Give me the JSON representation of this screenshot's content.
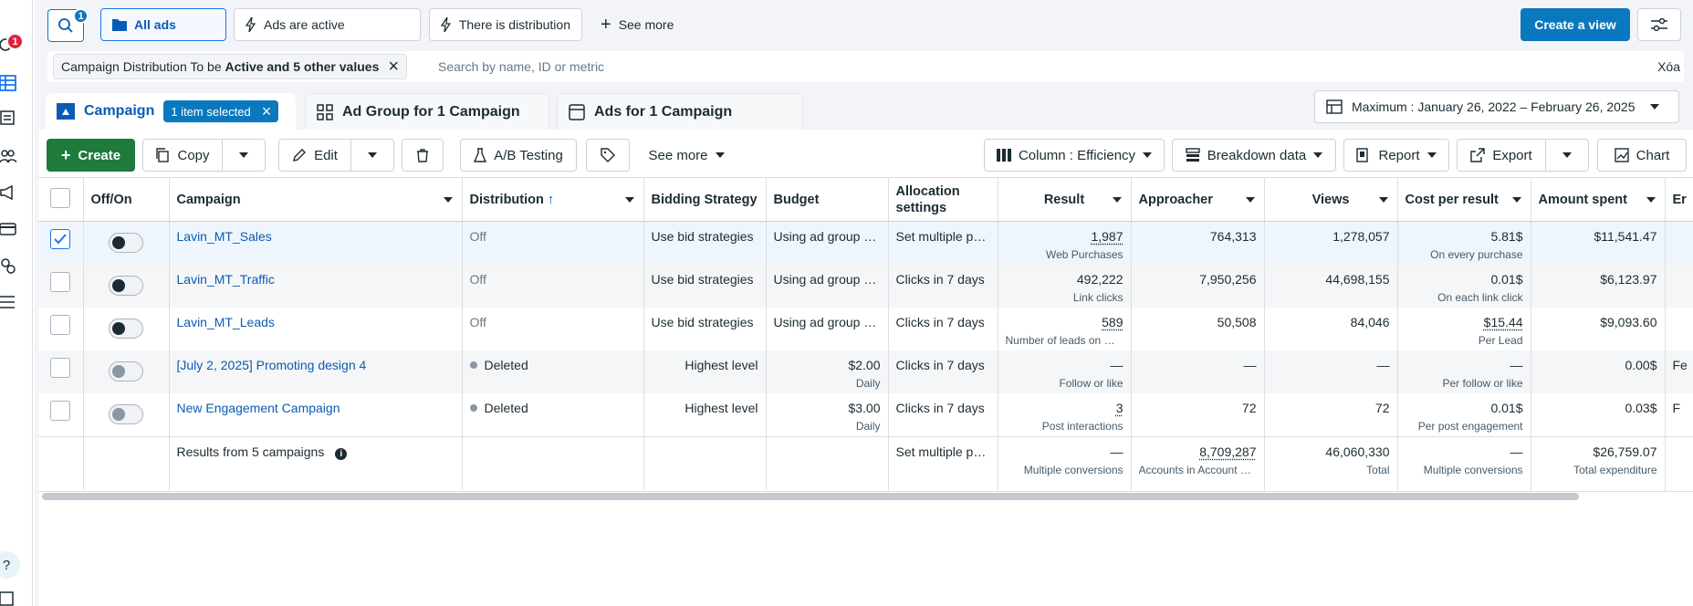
{
  "rail": {
    "badge": "1",
    "help": "?"
  },
  "topbar": {
    "search_badge": "1",
    "tabs": [
      "All ads",
      "Ads are active",
      "There is distribution"
    ],
    "see_more": "See more",
    "create_view": "Create a view"
  },
  "filter": {
    "chip_prefix": "Campaign Distribution To be",
    "chip_value": "Active and 5 other values",
    "search_placeholder": "Search by name, ID or metric",
    "clear": "Xóa"
  },
  "level_tabs": {
    "campaign": "Campaign",
    "selected_pill": "1 item selected",
    "ad_group": "Ad Group for 1 Campaign",
    "ads": "Ads for 1 Campaign"
  },
  "date_range": "Maximum : January 26, 2022 – February 26, 2025",
  "toolbar": {
    "create": "Create",
    "copy": "Copy",
    "edit": "Edit",
    "ab_testing": "A/B Testing",
    "see_more": "See more",
    "column": "Column : Efficiency",
    "breakdown": "Breakdown data",
    "report": "Report",
    "export": "Export",
    "chart": "Chart"
  },
  "table": {
    "headers": {
      "offon": "Off/On",
      "campaign": "Campaign",
      "distribution": "Distribution",
      "bidding": "Bidding Strategy",
      "budget": "Budget",
      "allocation": "Allocation settings",
      "result": "Result",
      "approacher": "Approacher",
      "views": "Views",
      "cpr": "Cost per result",
      "spent": "Amount spent",
      "extra": "Er"
    },
    "rows": [
      {
        "name": "Lavin_MT_Sales",
        "distribution": "Off",
        "bidding": "Use bid strategies",
        "budget": "Using ad group budget",
        "budget_sub": "",
        "allocation": "Set multiple presets",
        "result": "1,987",
        "result_sub": "Web Purchases",
        "approacher": "764,313",
        "views": "1,278,057",
        "cpr": "5.81$",
        "cpr_sub": "On every purchase",
        "spent": "$11,541.47",
        "extra": ""
      },
      {
        "name": "Lavin_MT_Traffic",
        "distribution": "Off",
        "bidding": "Use bid strategies",
        "budget": "Using ad group budget",
        "budget_sub": "",
        "allocation": "Clicks in 7 days",
        "result": "492,222",
        "result_sub": "Link clicks",
        "approacher": "7,950,256",
        "views": "44,698,155",
        "cpr": "0.01$",
        "cpr_sub": "On each link click",
        "spent": "$6,123.97",
        "extra": ""
      },
      {
        "name": "Lavin_MT_Leads",
        "distribution": "Off",
        "bidding": "Use bid strategies",
        "budget": "Using ad group budget",
        "budget_sub": "",
        "allocation": "Clicks in 7 days",
        "result": "589",
        "result_sub": "Number of leads on Meta",
        "approacher": "50,508",
        "views": "84,046",
        "cpr": "$15.44",
        "cpr_sub": "Per Lead",
        "spent": "$9,093.60",
        "extra": ""
      },
      {
        "name": "[July 2, 2025] Promoting design 4",
        "distribution": "Deleted",
        "bidding": "Highest level",
        "budget": "$2.00",
        "budget_sub": "Daily",
        "allocation": "Clicks in 7 days",
        "result": "—",
        "result_sub": "Follow or like",
        "approacher": "—",
        "views": "—",
        "cpr": "—",
        "cpr_sub": "Per follow or like",
        "spent": "0.00$",
        "extra": "Fe"
      },
      {
        "name": "New Engagement Campaign",
        "distribution": "Deleted",
        "bidding": "Highest level",
        "budget": "$3.00",
        "budget_sub": "Daily",
        "allocation": "Clicks in 7 days",
        "result": "3",
        "result_sub": "Post interactions",
        "approacher": "72",
        "views": "72",
        "cpr": "0.01$",
        "cpr_sub": "Per post engagement",
        "spent": "0.03$",
        "extra": "F"
      }
    ],
    "total": {
      "label": "Results from 5 campaigns",
      "allocation": "Set multiple presets",
      "result": "—",
      "result_sub": "Multiple conversions",
      "approacher": "8,709,287",
      "approacher_sub": "Accounts in Account Center",
      "views": "46,060,330",
      "views_sub": "Total",
      "cpr": "—",
      "cpr_sub": "Multiple conversions",
      "spent": "$26,759.07",
      "spent_sub": "Total expenditure"
    }
  }
}
